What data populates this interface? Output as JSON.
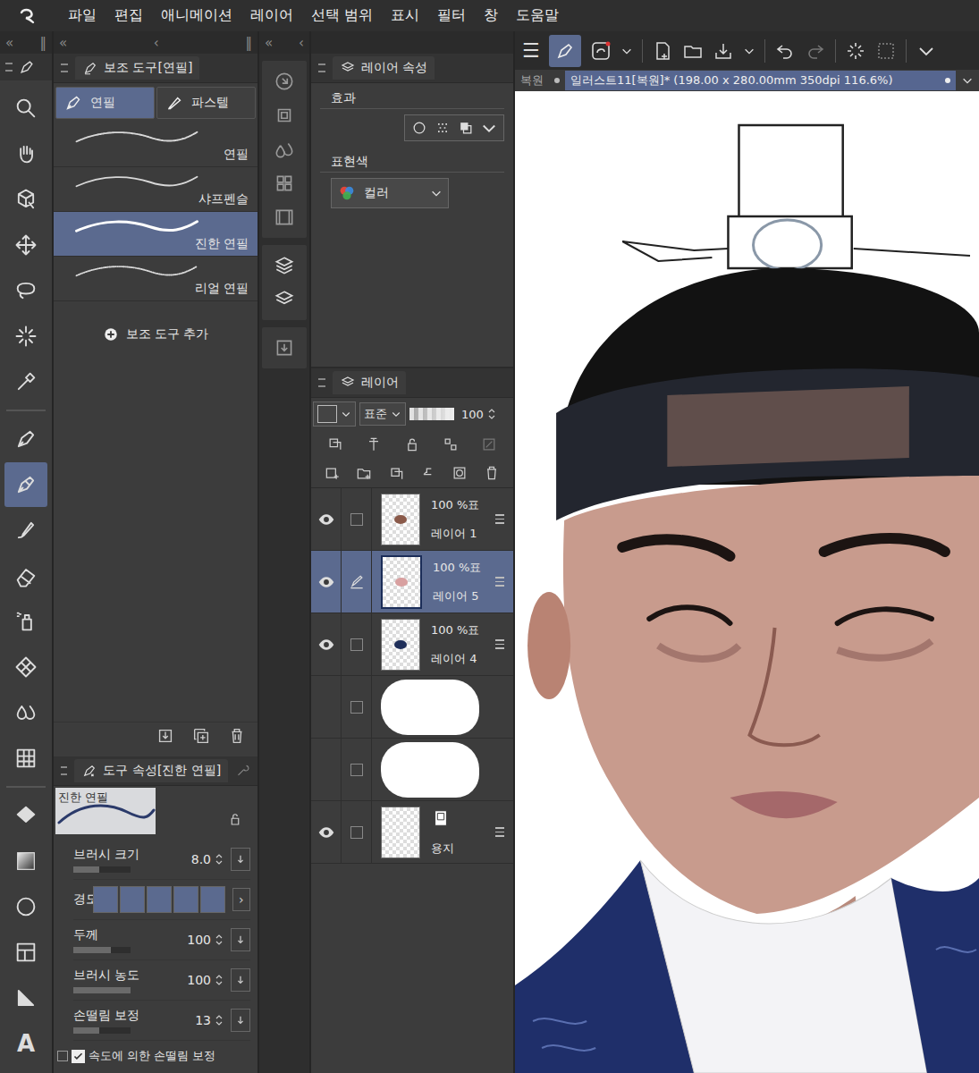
{
  "menu": [
    "파일",
    "편집",
    "애니메이션",
    "레이어",
    "선택 범위",
    "표시",
    "필터",
    "창",
    "도움말"
  ],
  "strips": {
    "tools": [
      "«",
      "‖"
    ],
    "subtool": [
      "«",
      "‹",
      "‖"
    ],
    "narrow": [
      "«",
      "‹"
    ]
  },
  "tools": [
    {
      "selected": false
    },
    {
      "selected": false
    },
    {
      "selected": false
    },
    {
      "selected": false
    },
    {
      "selected": false
    },
    {
      "selected": false
    },
    {
      "selected": false
    },
    {
      "selected": false
    },
    {
      "selected": true
    },
    {
      "selected": false
    },
    {
      "selected": false
    },
    {
      "selected": false
    },
    {
      "selected": false
    },
    {
      "selected": false
    },
    {
      "selected": false
    },
    {
      "selected": false
    },
    {
      "selected": false
    },
    {
      "selected": false
    },
    {
      "selected": false
    },
    {
      "selected": false
    },
    {
      "selected": false,
      "glyph": "A"
    }
  ],
  "subtool": {
    "title": "보조 도구[연필]",
    "groups": [
      {
        "label": "연필",
        "selected": true
      },
      {
        "label": "파스텔",
        "selected": false
      }
    ],
    "brushes": [
      {
        "name": "연필",
        "selected": false
      },
      {
        "name": "샤프펜슬",
        "selected": false
      },
      {
        "name": "진한 연필",
        "selected": true
      },
      {
        "name": "리얼 연필",
        "selected": false
      }
    ],
    "add": "보조 도구 추가"
  },
  "tool_property": {
    "title": "도구 속성[진한 연필]",
    "preview": "진한 연필",
    "props": [
      {
        "kind": "slider",
        "label": "브러시 크기",
        "value": "8.0",
        "level": 0.45
      },
      {
        "kind": "segments",
        "label": "경도",
        "level": 1
      },
      {
        "kind": "slider",
        "label": "두께",
        "value": "100",
        "level": 0.65
      },
      {
        "kind": "slider",
        "label": "브러시 농도",
        "value": "100",
        "level": 1
      },
      {
        "kind": "slider",
        "label": "손떨림 보정",
        "value": "13",
        "level": 0.45
      }
    ],
    "check": {
      "label": "속도에 의한 손떨림 보정",
      "checked": true
    }
  },
  "layer_property": {
    "title": "레이어 속성",
    "effect_label": "효과",
    "color_label": "표현색",
    "color_value": "컬러"
  },
  "layers": {
    "title": "레이어",
    "blend": "표준",
    "opacity": "100",
    "opacity_level": 1,
    "items": [
      {
        "kind": "layer",
        "name": "레이어 1",
        "info": "100 %표",
        "visible": true,
        "selected": false,
        "editing": false,
        "color": "#8a5a4a"
      },
      {
        "kind": "layer",
        "name": "레이어 5",
        "info": "100 %표",
        "visible": true,
        "selected": true,
        "editing": true,
        "color": "#d8a0a0"
      },
      {
        "kind": "layer",
        "name": "레이어 4",
        "info": "100 %표",
        "visible": true,
        "selected": false,
        "editing": false,
        "color": "#1f2f5a"
      },
      {
        "kind": "redacted",
        "visible": false,
        "selected": false,
        "editing": false
      },
      {
        "kind": "redacted",
        "visible": false,
        "selected": false,
        "editing": false
      },
      {
        "kind": "paper",
        "name": "용지",
        "visible": true,
        "selected": false,
        "editing": false
      }
    ]
  },
  "canvas": {
    "menu_glyph": "☰",
    "tabs": [
      {
        "label": "복원",
        "selected": false
      },
      {
        "label": "일러스트11[복원]* (198.00 x 280.00mm 350dpi 116.6%)",
        "selected": true
      }
    ]
  }
}
